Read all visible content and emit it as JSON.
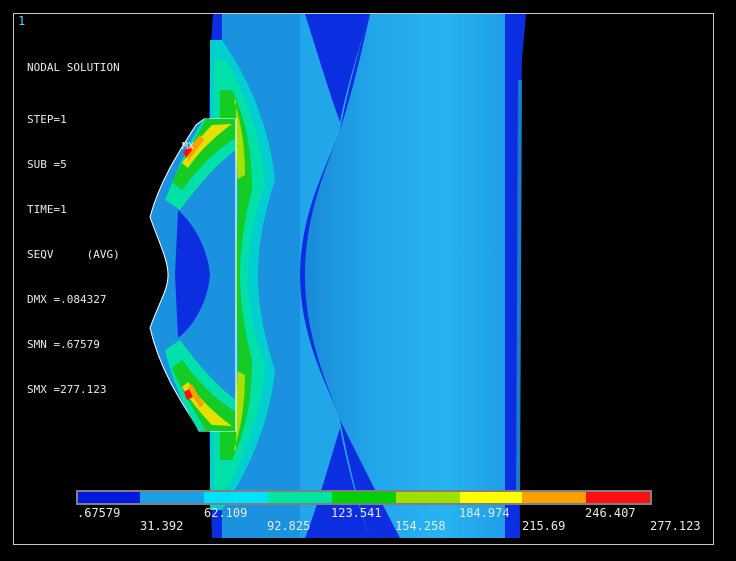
{
  "window_number": "1",
  "header": {
    "title": "NODAL SOLUTION",
    "lines": [
      "STEP=1",
      "SUB =5",
      "TIME=1",
      "SEQV     (AVG)",
      "DMX =.084327",
      "SMN =.67579",
      "SMX =277.123"
    ]
  },
  "max_marker": "MX",
  "legend": {
    "colors": [
      "#0018e0",
      "#1aa0e6",
      "#00e0ff",
      "#00e6a0",
      "#00d000",
      "#a0e000",
      "#ffff00",
      "#ffa000",
      "#ff1010"
    ],
    "top_labels": [
      ".67579",
      "62.109",
      "123.541",
      "184.974",
      "246.407"
    ],
    "bottom_labels": [
      "31.392",
      "92.825",
      "154.258",
      "215.69",
      "277.123"
    ]
  },
  "colors": {
    "background": "#000000",
    "dark_blue": "#0018e0",
    "mid_blue": "#1aa0e6",
    "light_blue": "#22b4f0",
    "cyan": "#00e0ff",
    "teal_green": "#00e6a0",
    "green": "#00d000",
    "yellow_green": "#a0e000",
    "orange": "#ffa000",
    "red": "#ff1010"
  }
}
